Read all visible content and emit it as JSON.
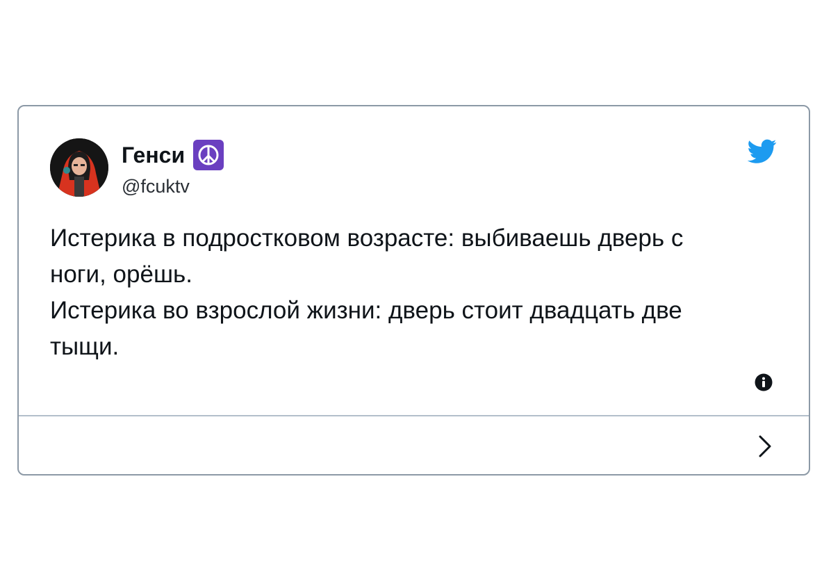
{
  "author": {
    "display_name": "Генси",
    "handle": "@fcuktv",
    "badge_icon": "peace-symbol-icon",
    "avatar_icon": "avatar-image"
  },
  "tweet": {
    "paragraph_1": "Истерика в подростковом возрасте: выбиваешь дверь с ноги, орёшь.",
    "paragraph_2": "Истерика во взрослой жизни: дверь стоит двадцать две тыщи."
  },
  "icons": {
    "brand": "twitter-bird-icon",
    "info": "info-icon",
    "next": "chevron-right-icon"
  },
  "colors": {
    "twitter_blue": "#1d9bf0",
    "badge_purple": "#6a3fc0",
    "border": "#8c99a6",
    "text": "#0f1419"
  }
}
